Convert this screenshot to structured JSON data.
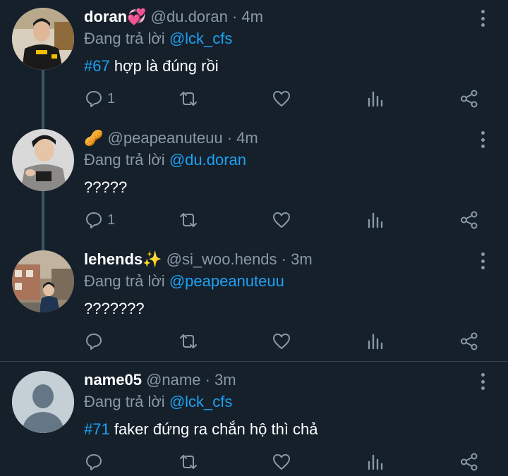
{
  "tweets": [
    {
      "name": "doran",
      "name_emoji": "💞",
      "handle": "@du.doran",
      "time": "4m",
      "reply_prefix": "Đang trả lời",
      "reply_to": "@lck_cfs",
      "body_link": "#67",
      "body_text": " hợp là đúng rồi",
      "reply_count": "1"
    },
    {
      "name": "",
      "name_emoji": "🥜",
      "handle": "@peapeanuteuu",
      "time": "4m",
      "reply_prefix": "Đang trả lời",
      "reply_to": "@du.doran",
      "body_link": "",
      "body_text": "?????",
      "reply_count": "1"
    },
    {
      "name": "lehends",
      "name_emoji": "✨",
      "handle": "@si_woo.hends",
      "time": "3m",
      "reply_prefix": "Đang trả lời",
      "reply_to": "@peapeanuteuu",
      "body_link": "",
      "body_text": "???????",
      "reply_count": ""
    },
    {
      "name": "name05",
      "name_emoji": "",
      "handle": "@name",
      "time": "3m",
      "reply_prefix": "Đang trả lời",
      "reply_to": "@lck_cfs",
      "body_link": "#71",
      "body_text": " faker đứng ra chắn hộ thì chả",
      "reply_count": ""
    }
  ],
  "separator": "·",
  "colors": {
    "background": "#15202b",
    "text_secondary": "#8899a6",
    "link": "#1da1f2",
    "divider": "#38444d"
  },
  "icons": [
    "reply-icon",
    "retweet-icon",
    "like-icon",
    "analytics-icon",
    "share-icon",
    "more-options-icon"
  ]
}
